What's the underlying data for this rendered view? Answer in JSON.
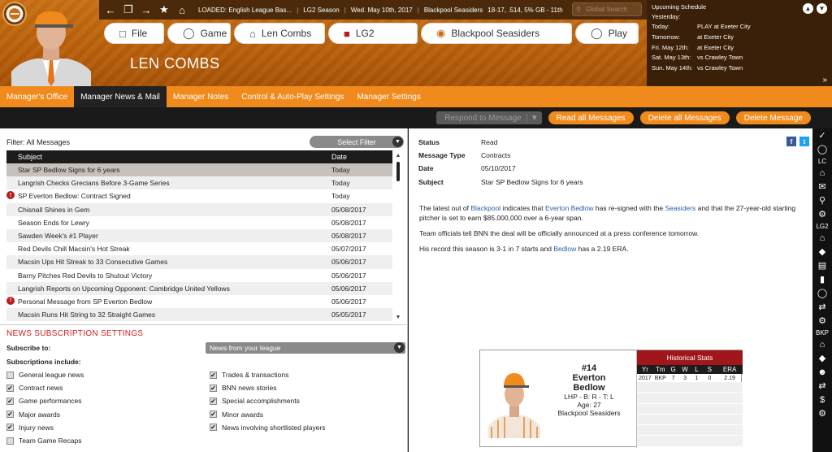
{
  "topbar": {
    "loaded": "LOADED: English League Bas...",
    "league": "LG2 Season",
    "date": "Wed. May 10th, 2017",
    "team_record": "Blackpool Seasiders",
    "record": "18-17, .514, 5% GB - 11th",
    "search_placeholder": "Global Search"
  },
  "nav": {
    "file": "File",
    "game": "Game",
    "player": "Len Combs",
    "league": "LG2",
    "team": "Blackpool Seasiders",
    "play": "Play"
  },
  "player_name": "LEN COMBS",
  "schedule": {
    "title": "Upcoming Schedule",
    "rows": [
      {
        "day": "Yesterday:",
        "game": ""
      },
      {
        "day": "Today:",
        "game": "PLAY at Exeter City"
      },
      {
        "day": "Tomorrow:",
        "game": "at Exeter City"
      },
      {
        "day": "Fri. May 12th:",
        "game": "at Exeter City"
      },
      {
        "day": "Sat. May 13th:",
        "game": "vs Crawley Town"
      },
      {
        "day": "Sun. May 14th:",
        "game": "vs Crawley Town"
      }
    ]
  },
  "menu": [
    "Manager's Office",
    "Manager News & Mail",
    "Manager Notes",
    "Control & Auto-Play Settings",
    "Manager Settings"
  ],
  "actions": {
    "respond": "Respond to Message",
    "read_all": "Read all Messages",
    "delete_all": "Delete all Messages",
    "delete": "Delete Message"
  },
  "filter": {
    "label": "Filter: All Messages",
    "select": "Select Filter"
  },
  "table": {
    "headers": [
      "Subject",
      "Date"
    ],
    "rows": [
      {
        "subject": "Star SP Bedlow Signs for 6 years",
        "date": "Today",
        "alert": false
      },
      {
        "subject": "Langrish Checks Grecians Before 3-Game Series",
        "date": "Today",
        "alert": false
      },
      {
        "subject": "SP Everton Bedlow: Contract Signed",
        "date": "Today",
        "alert": true
      },
      {
        "subject": "Chisnall Shines in Gem",
        "date": "05/08/2017",
        "alert": false
      },
      {
        "subject": "Season Ends for Lewry",
        "date": "05/08/2017",
        "alert": false
      },
      {
        "subject": "Sawden Week's #1 Player",
        "date": "05/08/2017",
        "alert": false
      },
      {
        "subject": "Red Devils Chill Macsin's Hot Streak",
        "date": "05/07/2017",
        "alert": false
      },
      {
        "subject": "Macsin Ups Hit Streak to 33 Consecutive Games",
        "date": "05/06/2017",
        "alert": false
      },
      {
        "subject": "Barny Pitches Red Devils to Shutout Victory",
        "date": "05/06/2017",
        "alert": false
      },
      {
        "subject": "Langrish Reports on Upcoming Opponent: Cambridge United Yellows",
        "date": "05/06/2017",
        "alert": false
      },
      {
        "subject": "Personal Message from SP Everton Bedlow",
        "date": "05/06/2017",
        "alert": true
      },
      {
        "subject": "Macsin Runs Hit String to 32 Straight Games",
        "date": "05/05/2017",
        "alert": false
      }
    ]
  },
  "subscriptions": {
    "title": "NEWS SUBSCRIPTION SETTINGS",
    "subscribe_to": "Subscribe to:",
    "source": "News from your league",
    "include": "Subscriptions include:",
    "left": [
      {
        "label": "General league news",
        "checked": false
      },
      {
        "label": "Contract news",
        "checked": true
      },
      {
        "label": "Game performances",
        "checked": true
      },
      {
        "label": "Major awards",
        "checked": true
      },
      {
        "label": "Injury news",
        "checked": true
      },
      {
        "label": "Team Game Recaps",
        "checked": false
      }
    ],
    "right": [
      {
        "label": "Trades & transactions",
        "checked": true
      },
      {
        "label": "BNN news stories",
        "checked": true
      },
      {
        "label": "Special accomplishments",
        "checked": true
      },
      {
        "label": "Minor awards",
        "checked": true
      },
      {
        "label": "News involving shortlisted players",
        "checked": true
      }
    ]
  },
  "message": {
    "status_label": "Status",
    "status": "Read",
    "type_label": "Message Type",
    "type": "Contracts",
    "date_label": "Date",
    "date": "05/10/2017",
    "subject_label": "Subject",
    "subject": "Star SP Bedlow Signs for 6 years",
    "p1a": "The latest out of ",
    "p1_link1": "Blackpool",
    "p1b": " indicates that ",
    "p1_link2": "Everton Bedlow",
    "p1c": " has re-signed with the ",
    "p1_link3": "Seasiders",
    "p1d": " and that the 27-year-old starting pitcher is set to earn $85,000,000 over a 6-year span.",
    "p2": "Team officials tell BNN the deal will be officially announced at a press conference tomorrow.",
    "p3a": "His record this season is 3-1 in 7 starts and ",
    "p3_link": "Bedlow",
    "p3b": " has a 2.19 ERA."
  },
  "card": {
    "number": "#14",
    "first": "Everton",
    "last": "Bedlow",
    "pos": "LHP - B: R - T: L",
    "age": "Age: 27",
    "team": "Blackpool Seasiders",
    "hist_title": "Historical Stats",
    "hist_headers": [
      "Yr",
      "Tm",
      "G",
      "W",
      "L",
      "S",
      "ERA"
    ],
    "hist_row": [
      "2017",
      "BKP",
      "7",
      "3",
      "1",
      "0",
      "2.19"
    ]
  },
  "rail": {
    "lc": "LC",
    "lg2": "LG2",
    "bkp": "BKP"
  }
}
